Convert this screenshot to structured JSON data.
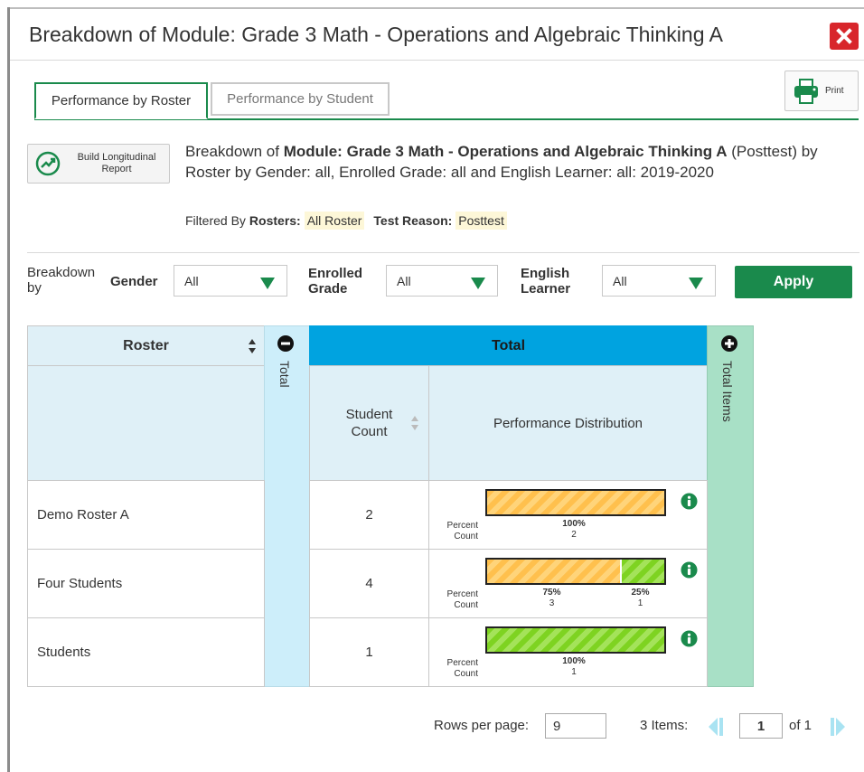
{
  "header": {
    "title": "Breakdown of Module: Grade 3 Math - Operations and Algebraic Thinking A",
    "close_icon": "close-icon"
  },
  "tabs": [
    {
      "label": "Performance by Roster",
      "active": true
    },
    {
      "label": "Performance by Student",
      "active": false
    }
  ],
  "print": {
    "label": "Print",
    "icon": "printer-icon"
  },
  "build_report": {
    "label": "Build Longitudinal Report",
    "icon": "trend-chart-icon"
  },
  "description": {
    "prefix": "Breakdown of ",
    "module": "Module: Grade 3 Math - Operations and Algebraic Thinking A",
    "suffix": " (Posttest) by Roster by Gender: all, Enrolled Grade: all and English Learner: all: 2019-2020"
  },
  "filtered": {
    "prefix": "Filtered By",
    "rosters_label": "Rosters:",
    "rosters_value": "All Roster",
    "reason_label": "Test Reason:",
    "reason_value": "Posttest"
  },
  "filters": {
    "breakdown_label": "Breakdown by",
    "gender_label": "Gender",
    "gender_value": "All",
    "grade_label": "Enrolled Grade",
    "grade_value": "All",
    "el_label": "English Learner",
    "el_value": "All",
    "apply_label": "Apply"
  },
  "table": {
    "roster_header": "Roster",
    "total_col_label": "Total",
    "total_band": "Total",
    "student_count_header": "Student Count",
    "perf_dist_header": "Performance Distribution",
    "total_items_label": "Total Items",
    "percent_label": "Percent",
    "count_label": "Count",
    "colors": {
      "orange": "#ffc04d",
      "green": "#7ed321",
      "header_blue": "#00a3e0",
      "accent_green": "#1a8a4c"
    },
    "rows": [
      {
        "name": "Demo Roster A",
        "count": "2",
        "segments": [
          {
            "color": "orange",
            "percent": "100%",
            "count": "2",
            "fraction": 1.0
          }
        ]
      },
      {
        "name": "Four Students",
        "count": "4",
        "segments": [
          {
            "color": "orange",
            "percent": "75%",
            "count": "3",
            "fraction": 0.75
          },
          {
            "color": "green",
            "percent": "25%",
            "count": "1",
            "fraction": 0.25
          }
        ]
      },
      {
        "name": "Students",
        "count": "1",
        "segments": [
          {
            "color": "green",
            "percent": "100%",
            "count": "1",
            "fraction": 1.0
          }
        ]
      }
    ]
  },
  "pager": {
    "rows_per_page_label": "Rows per page:",
    "rows_per_page": "9",
    "items_label": "3 Items:",
    "page": "1",
    "of_label": "of 1"
  }
}
